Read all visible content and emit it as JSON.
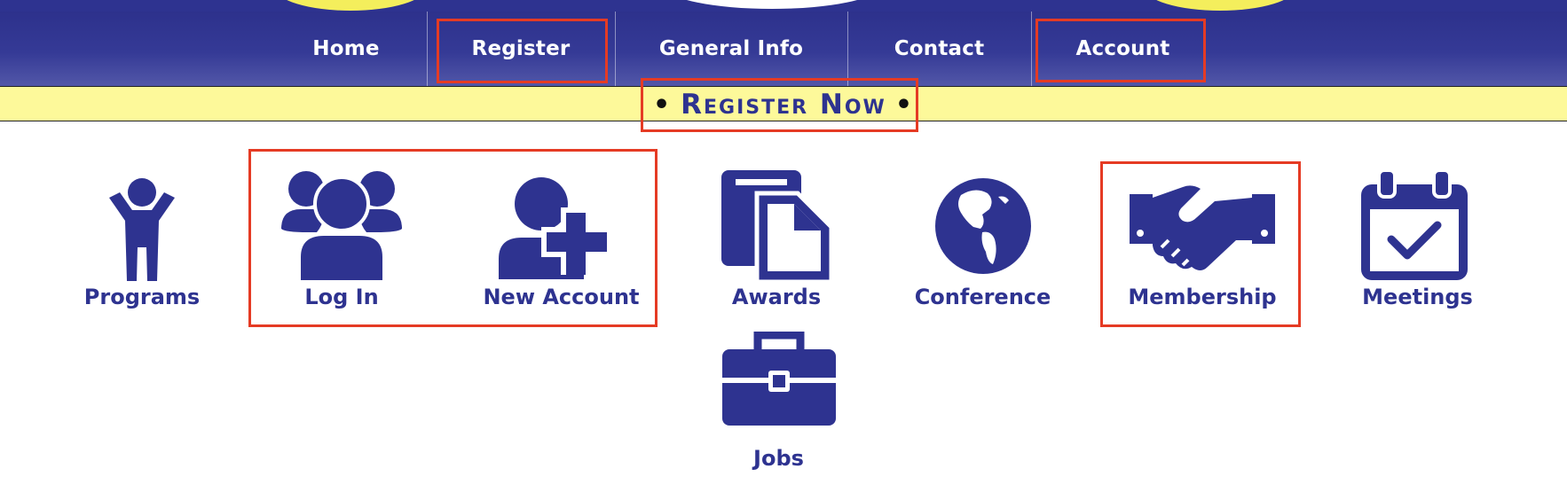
{
  "nav": {
    "home": "Home",
    "register": "Register",
    "general_info": "General Info",
    "contact": "Contact",
    "account": "Account"
  },
  "banner": {
    "text": "Register Now",
    "bullet": "•"
  },
  "tiles": {
    "programs": {
      "label": "Programs",
      "icon": "person-arms-up-icon"
    },
    "login": {
      "label": "Log In",
      "icon": "users-group-icon"
    },
    "new_account": {
      "label": "New Account",
      "icon": "user-plus-icon"
    },
    "awards": {
      "label": "Awards",
      "icon": "documents-icon"
    },
    "conference": {
      "label": "Conference",
      "icon": "globe-icon"
    },
    "membership": {
      "label": "Membership",
      "icon": "handshake-icon"
    },
    "meetings": {
      "label": "Meetings",
      "icon": "calendar-check-icon"
    },
    "jobs": {
      "label": "Jobs",
      "icon": "briefcase-icon"
    }
  },
  "colors": {
    "brand_blue": "#2e3390",
    "banner_yellow": "#fdf99a",
    "highlight_red": "#e53b24"
  }
}
